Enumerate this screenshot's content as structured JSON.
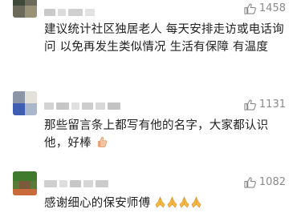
{
  "comments": [
    {
      "likes": "1458",
      "text": "建议统计社区独居老人 每天安排走访或电话询问 以免再发生类似情况 生活有保障 有温度"
    },
    {
      "likes": "1131",
      "text": "那些留言条上都写有他的名字，大家都认识他，好棒",
      "trailing_emoji": "thumbs-up-emoji"
    },
    {
      "likes": "1082",
      "text": "感谢细心的保安师傅",
      "trailing_emoji": "praying-hands-emoji x4"
    }
  ],
  "icons": {
    "like": "thumbs-up-icon"
  },
  "colors": {
    "like_text": "#8a8a8a",
    "body_text": "#222222"
  }
}
